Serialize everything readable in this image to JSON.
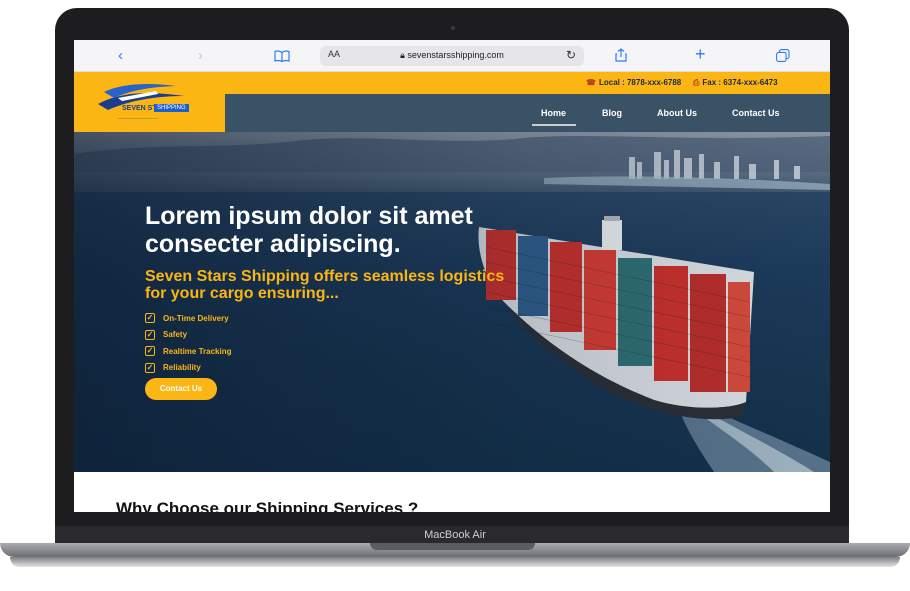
{
  "device": {
    "label": "MacBook Air"
  },
  "browser": {
    "back_icon": "chevron-left-icon",
    "forward_icon": "chevron-right-icon",
    "bookmarks_icon": "book-icon",
    "text_size_label": "AA",
    "url": "sevenstarsshipping.com",
    "reload_icon": "reload-icon",
    "share_icon": "share-icon",
    "new_tab_icon": "plus-icon",
    "tabs_icon": "tabs-icon"
  },
  "infobar": {
    "local": "Local : 7878-xxx-6788",
    "fax": "Fax : 6374-xxx-6473"
  },
  "logo": {
    "name": "SEVEN STARS",
    "tag": "SHIPPING"
  },
  "nav": {
    "items": [
      "Home",
      "Blog",
      "About Us",
      "Contact Us"
    ],
    "active": "Home"
  },
  "hero": {
    "title": "Lorem ipsum dolor sit amet consecter adipiscing.",
    "subtitle": "Seven Stars Shipping offers seamless logistics for your cargo ensuring...",
    "features": [
      "On-Time Delivery",
      "Safety",
      "Realtime Tracking",
      "Reliability"
    ],
    "cta": "Contact Us"
  },
  "section": {
    "title": "Why Choose our Shipping Services ?"
  },
  "colors": {
    "accent": "#fbb614",
    "nav_bg": "#3a5266",
    "link_blue": "#2f7bf5"
  }
}
